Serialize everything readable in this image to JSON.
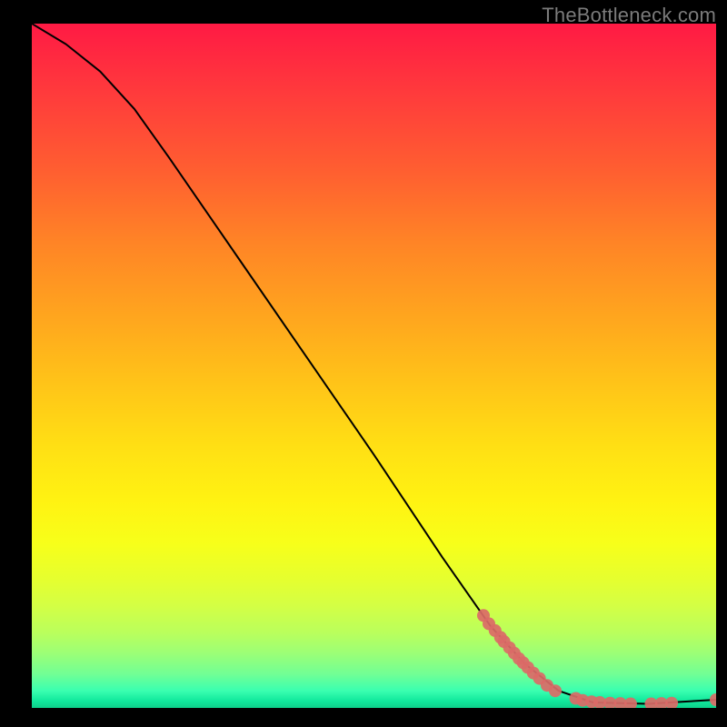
{
  "watermark": "TheBottleneck.com",
  "chart_data": {
    "type": "line",
    "title": "",
    "xlabel": "",
    "ylabel": "",
    "xlim": [
      0,
      100
    ],
    "ylim": [
      0,
      100
    ],
    "curve": [
      {
        "x": 0,
        "y": 100
      },
      {
        "x": 5,
        "y": 97
      },
      {
        "x": 10,
        "y": 93
      },
      {
        "x": 15,
        "y": 87.5
      },
      {
        "x": 20,
        "y": 80.5
      },
      {
        "x": 30,
        "y": 66
      },
      {
        "x": 40,
        "y": 51.5
      },
      {
        "x": 50,
        "y": 37
      },
      {
        "x": 60,
        "y": 22
      },
      {
        "x": 67,
        "y": 12
      },
      {
        "x": 72,
        "y": 6.5
      },
      {
        "x": 77,
        "y": 2.5
      },
      {
        "x": 82,
        "y": 0.8
      },
      {
        "x": 90,
        "y": 0.6
      },
      {
        "x": 100,
        "y": 1.2
      }
    ],
    "markers": [
      {
        "x": 66,
        "y": 13.5
      },
      {
        "x": 66.8,
        "y": 12.3
      },
      {
        "x": 67.7,
        "y": 11.3
      },
      {
        "x": 68.5,
        "y": 10.3
      },
      {
        "x": 69.0,
        "y": 9.7
      },
      {
        "x": 69.8,
        "y": 8.8
      },
      {
        "x": 70.5,
        "y": 8.0
      },
      {
        "x": 71.2,
        "y": 7.2
      },
      {
        "x": 71.8,
        "y": 6.6
      },
      {
        "x": 72.5,
        "y": 5.9
      },
      {
        "x": 73.3,
        "y": 5.1
      },
      {
        "x": 74.2,
        "y": 4.3
      },
      {
        "x": 75.3,
        "y": 3.3
      },
      {
        "x": 76.5,
        "y": 2.5
      },
      {
        "x": 79.5,
        "y": 1.4
      },
      {
        "x": 80.5,
        "y": 1.1
      },
      {
        "x": 81.8,
        "y": 0.9
      },
      {
        "x": 83.0,
        "y": 0.8
      },
      {
        "x": 84.5,
        "y": 0.7
      },
      {
        "x": 86.0,
        "y": 0.65
      },
      {
        "x": 87.5,
        "y": 0.6
      },
      {
        "x": 90.5,
        "y": 0.6
      },
      {
        "x": 92.0,
        "y": 0.65
      },
      {
        "x": 93.5,
        "y": 0.7
      },
      {
        "x": 100,
        "y": 1.2
      }
    ],
    "marker_color": "#db6a67",
    "line_color": "#000000"
  }
}
